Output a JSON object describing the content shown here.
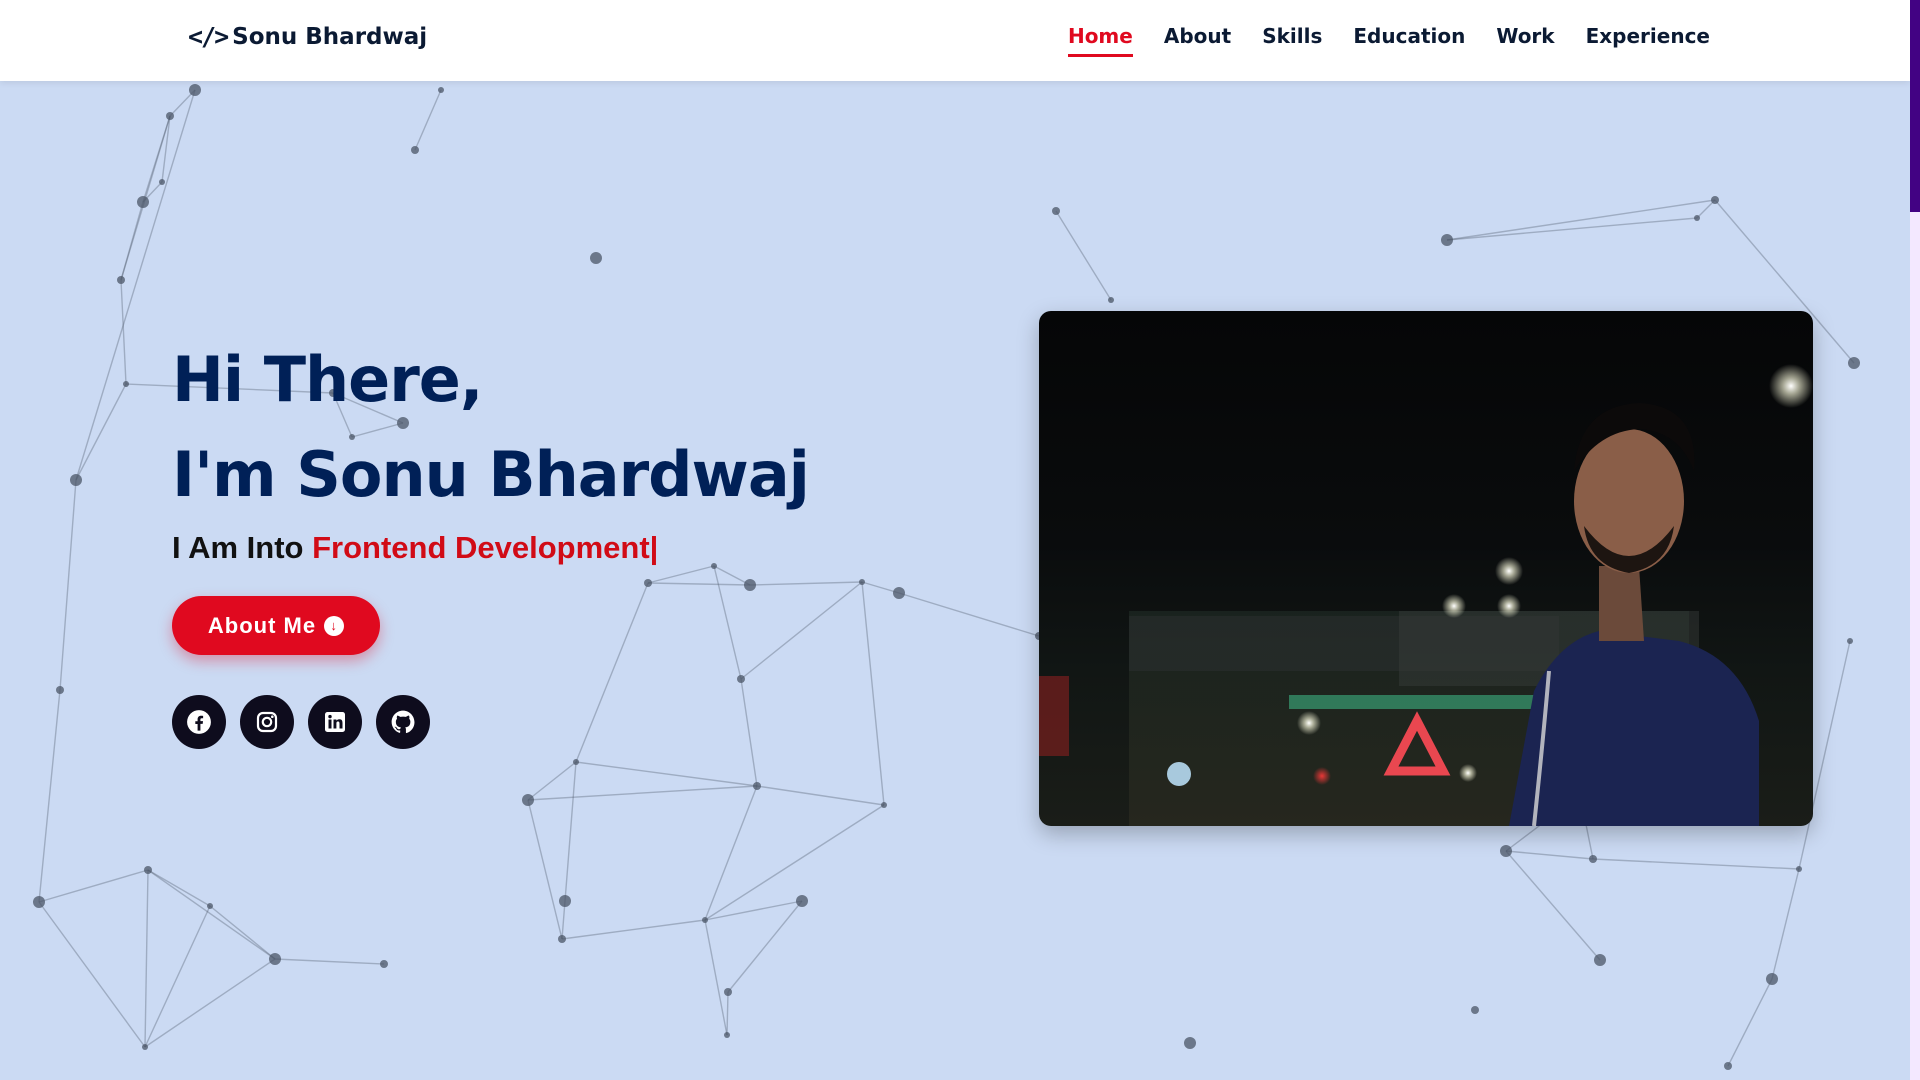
{
  "header": {
    "brand": "Sonu Bhardwaj",
    "brand_icon": "code-icon",
    "nav": [
      {
        "label": "Home",
        "active": true
      },
      {
        "label": "About",
        "active": false
      },
      {
        "label": "Skills",
        "active": false
      },
      {
        "label": "Education",
        "active": false
      },
      {
        "label": "Work",
        "active": false
      },
      {
        "label": "Experience",
        "active": false
      }
    ]
  },
  "hero": {
    "greeting": "Hi There,",
    "name_line": "I'm Sonu Bhardwaj",
    "tagline_prefix": "I Am Into",
    "tagline_typed": "Frontend Development",
    "cursor": "|",
    "about_button": "About Me",
    "about_button_icon": "arrow-down-circle-icon",
    "socials": [
      {
        "name": "facebook-icon"
      },
      {
        "name": "instagram-icon"
      },
      {
        "name": "linkedin-icon"
      },
      {
        "name": "github-icon"
      }
    ]
  },
  "photo": {
    "subject": "portrait photo of a man in a navy hoodie at night"
  },
  "colors": {
    "accent": "#e0091f",
    "heading": "#002057",
    "background": "#cbdaf3",
    "scrollbar_thumb": "#420283",
    "social_bg": "#0e0c1d"
  }
}
